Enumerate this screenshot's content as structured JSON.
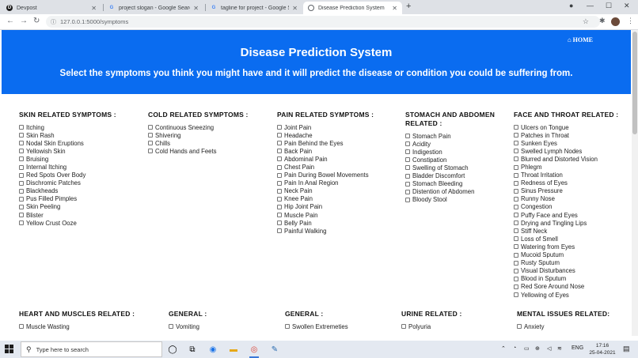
{
  "browser": {
    "tabs": [
      {
        "title": "Devpost",
        "favicon": "D",
        "active": false
      },
      {
        "title": "project slogan - Google Search",
        "favicon": "G",
        "active": false
      },
      {
        "title": "tagline for project - Google Sear",
        "favicon": "G",
        "active": false
      },
      {
        "title": "Disease Prediction System",
        "favicon": "globe",
        "active": true
      }
    ],
    "url": "127.0.0.1:5000/symptoms"
  },
  "page": {
    "home_label": "HOME",
    "title": "Disease Prediction System",
    "subtitle": "Select the symptoms you think you might have and it will predict the disease or condition you could be suffering from."
  },
  "groups": [
    {
      "heading": "SKIN RELATED SYMPTOMS :",
      "items": [
        "Itching",
        "Skin Rash",
        "Nodal Skin Eruptions",
        "Yellowish Skin",
        "Bruising",
        "Internal Itching",
        "Red Spots Over Body",
        "Dischromic Patches",
        "Blackheads",
        "Pus Filled Pimples",
        "Skin Peeling",
        "Blister",
        "Yellow Crust Ooze"
      ]
    },
    {
      "heading": "COLD RELATED SYMPTOMS :",
      "items": [
        "Continuous Sneezing",
        "Shivering",
        "Chills",
        "Cold Hands and Feets"
      ]
    },
    {
      "heading": "PAIN RELATED SYMPTOMS :",
      "items": [
        "Joint Pain",
        "Headache",
        "Pain Behind the Eyes",
        "Back Pain",
        "Abdominal Pain",
        "Chest Pain",
        "Pain During Bowel Movements",
        "Pain In Anal Region",
        "Neck Pain",
        "Knee Pain",
        "Hip Joint Pain",
        "Muscle Pain",
        "Belly Pain",
        "Painful Walking"
      ]
    },
    {
      "heading": "STOMACH AND ABDOMEN RELATED :",
      "items": [
        "Stomach Pain",
        "Acidity",
        "Indigestion",
        "Constipation",
        "Swelling of Stomach",
        "Bladder Discomfort",
        "Stomach Bleeding",
        "Distention of Abdomen",
        "Bloody Stool"
      ]
    },
    {
      "heading": "FACE AND THROAT RELATED :",
      "items": [
        "Ulcers on Tongue",
        "Patches in Throat",
        "Sunken Eyes",
        "Swelled Lymph Nodes",
        "Blurred and Distorted Vision",
        "Phlegm",
        "Throat Irritation",
        "Redness of Eyes",
        "Sinus Pressure",
        "Runny Nose",
        "Congestion",
        "Puffy Face and Eyes",
        "Drying and Tingling Lips",
        "Stiff Neck",
        "Loss of Smell",
        "Watering from Eyes",
        "Mucoid Sputum",
        "Rusty Sputum",
        "Visual Disturbances",
        "Blood in Sputum",
        "Red Sore Around Nose",
        "Yellowing of Eyes"
      ]
    },
    {
      "heading": "HEART AND MUSCLES RELATED :",
      "items": [
        "Muscle Wasting"
      ]
    },
    {
      "heading": "GENERAL :",
      "items": [
        "Vomiting"
      ]
    },
    {
      "heading": "GENERAL :",
      "items": [
        "Swollen Extremeties"
      ]
    },
    {
      "heading": "URINE RELATED :",
      "items": [
        "Polyuria"
      ]
    },
    {
      "heading": "MENTAL ISSUES RELATED:",
      "items": [
        "Anxiety"
      ]
    }
  ],
  "taskbar": {
    "search_placeholder": "Type here to search",
    "language": "ENG",
    "time": "17:16",
    "date": "25-04-2021"
  },
  "colors": {
    "banner": "#0a6cf0",
    "taskbar": "#e4e9f1"
  }
}
